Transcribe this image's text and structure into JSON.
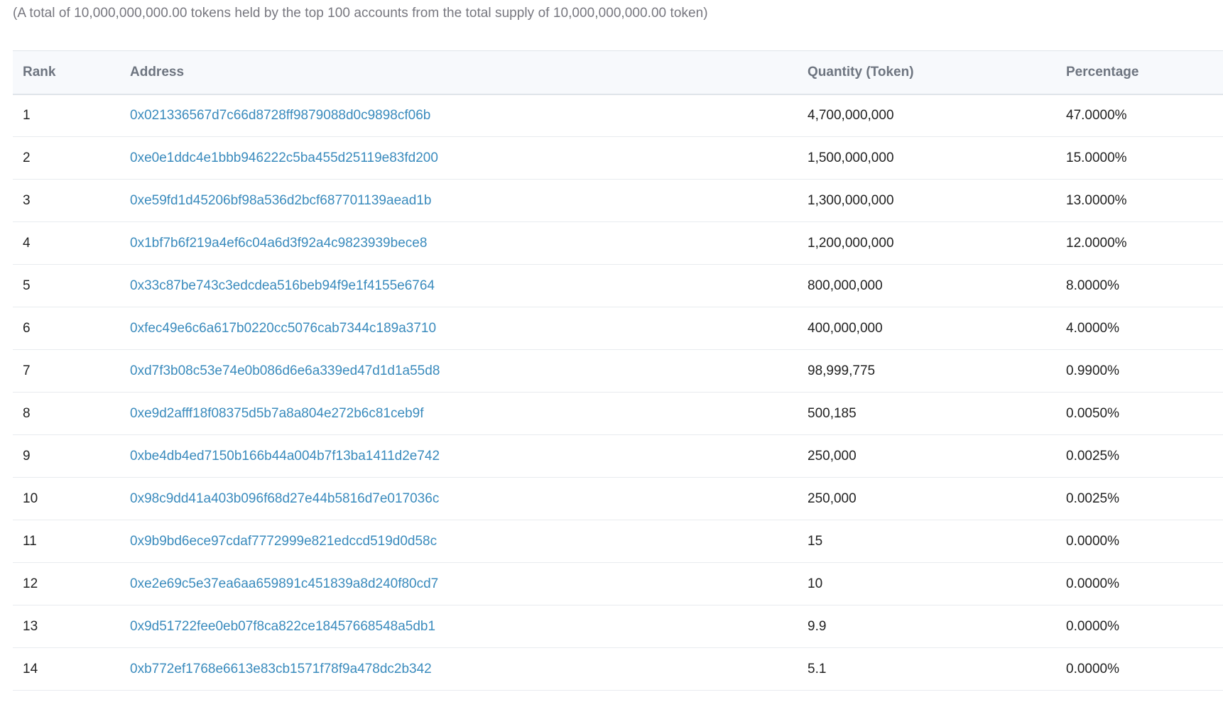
{
  "summary": "(A total of 10,000,000,000.00 tokens held by the top 100 accounts from the total supply of 10,000,000,000.00 token)",
  "colors": {
    "link": "#3a8bbd",
    "header_bg": "#f7f9fc",
    "header_text": "#6e7580",
    "summary_text": "#77777f"
  },
  "table": {
    "headers": {
      "rank": "Rank",
      "address": "Address",
      "quantity": "Quantity (Token)",
      "percentage": "Percentage"
    },
    "rows": [
      {
        "rank": "1",
        "address": "0x021336567d7c66d8728ff9879088d0c9898cf06b",
        "quantity": "4,700,000,000",
        "percentage": "47.0000%"
      },
      {
        "rank": "2",
        "address": "0xe0e1ddc4e1bbb946222c5ba455d25119e83fd200",
        "quantity": "1,500,000,000",
        "percentage": "15.0000%"
      },
      {
        "rank": "3",
        "address": "0xe59fd1d45206bf98a536d2bcf687701139aead1b",
        "quantity": "1,300,000,000",
        "percentage": "13.0000%"
      },
      {
        "rank": "4",
        "address": "0x1bf7b6f219a4ef6c04a6d3f92a4c9823939bece8",
        "quantity": "1,200,000,000",
        "percentage": "12.0000%"
      },
      {
        "rank": "5",
        "address": "0x33c87be743c3edcdea516beb94f9e1f4155e6764",
        "quantity": "800,000,000",
        "percentage": "8.0000%"
      },
      {
        "rank": "6",
        "address": "0xfec49e6c6a617b0220cc5076cab7344c189a3710",
        "quantity": "400,000,000",
        "percentage": "4.0000%"
      },
      {
        "rank": "7",
        "address": "0xd7f3b08c53e74e0b086d6e6a339ed47d1d1a55d8",
        "quantity": "98,999,775",
        "percentage": "0.9900%"
      },
      {
        "rank": "8",
        "address": "0xe9d2afff18f08375d5b7a8a804e272b6c81ceb9f",
        "quantity": "500,185",
        "percentage": "0.0050%"
      },
      {
        "rank": "9",
        "address": "0xbe4db4ed7150b166b44a004b7f13ba1411d2e742",
        "quantity": "250,000",
        "percentage": "0.0025%"
      },
      {
        "rank": "10",
        "address": "0x98c9dd41a403b096f68d27e44b5816d7e017036c",
        "quantity": "250,000",
        "percentage": "0.0025%"
      },
      {
        "rank": "11",
        "address": "0x9b9bd6ece97cdaf7772999e821edccd519d0d58c",
        "quantity": "15",
        "percentage": "0.0000%"
      },
      {
        "rank": "12",
        "address": "0xe2e69c5e37ea6aa659891c451839a8d240f80cd7",
        "quantity": "10",
        "percentage": "0.0000%"
      },
      {
        "rank": "13",
        "address": "0x9d51722fee0eb07f8ca822ce18457668548a5db1",
        "quantity": "9.9",
        "percentage": "0.0000%"
      },
      {
        "rank": "14",
        "address": "0xb772ef1768e6613e83cb1571f78f9a478dc2b342",
        "quantity": "5.1",
        "percentage": "0.0000%"
      }
    ]
  }
}
